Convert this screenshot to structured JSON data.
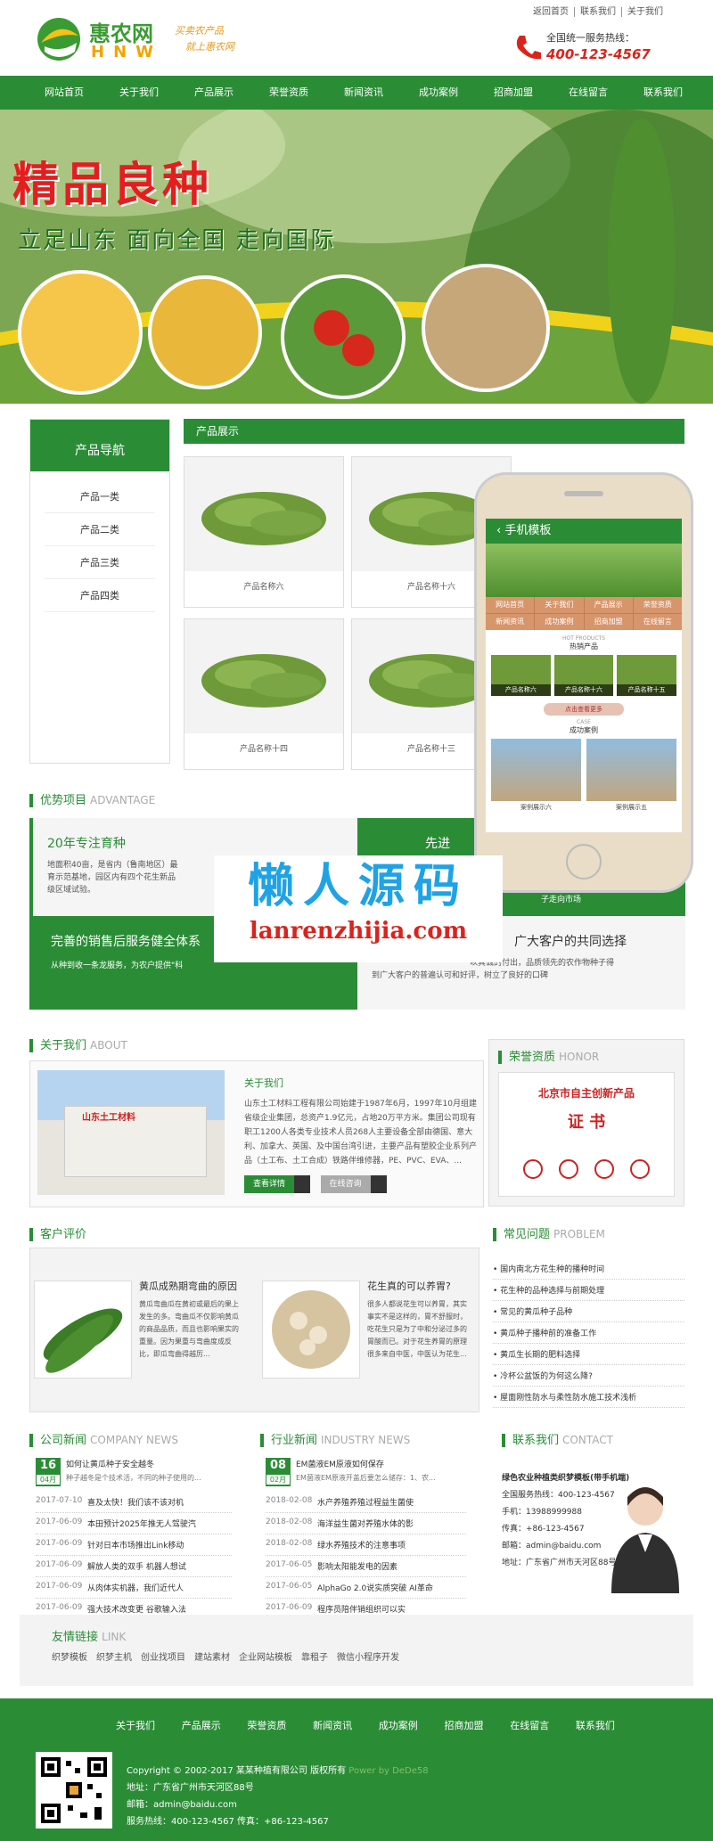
{
  "header": {
    "top_links": [
      "返回首页",
      "联系我们",
      "关于我们"
    ],
    "logo_cn": "惠农网",
    "logo_en": "HNW",
    "logo_slogan_1": "买卖农产品",
    "logo_slogan_2": "就上惠农网",
    "hotline_label": "全国统一服务热线：",
    "hotline_number": "400-123-4567"
  },
  "nav": [
    "网站首页",
    "关于我们",
    "产品展示",
    "荣誉资质",
    "新闻资讯",
    "成功案例",
    "招商加盟",
    "在线留言",
    "联系我们"
  ],
  "banner": {
    "title": "精品良种",
    "subtitle": "立足山东 面向全国 走向国际"
  },
  "sidenav": {
    "title": "产品导航",
    "items": [
      "产品一类",
      "产品二类",
      "产品三类",
      "产品四类"
    ]
  },
  "products": {
    "title": "产品展示",
    "items": [
      "产品名称六",
      "产品名称十六",
      "产品名称十四",
      "产品名称十三"
    ]
  },
  "phone": {
    "title": "手机模板",
    "menu": [
      "网站首页",
      "关于我们",
      "产品展示",
      "荣誉资质",
      "新闻资讯",
      "成功案例",
      "招商加盟",
      "在线留言"
    ],
    "hot_en": "HOT PRODUCTS",
    "hot_cn": "热销产品",
    "products": [
      "产品名称六",
      "产品名称十六",
      "产品名称十五"
    ],
    "more": "点击查看更多",
    "case_en": "CASE",
    "case_cn": "成功案例",
    "cases": [
      "案例展示六",
      "案例展示五"
    ]
  },
  "watermark": {
    "cn": "懒人源码",
    "en": "lanrenzhijia.com"
  },
  "advantage": {
    "title": "优势项目",
    "title_en": "ADVANTAGE",
    "item1_title": "20年专注育种",
    "item1_text_1": "地面积40亩，是省内（鲁南地区）最",
    "item1_text_2": "育示范基地，园区内有四个花生新品",
    "item1_text_3": "级区域试验。",
    "item2_title": "先进",
    "item2_side": "子走向市场",
    "item3_title": "完善的销售后服务健全体系",
    "item3_text": "从种到收一条龙服务，为农户提供\"科",
    "item4_title": "广大客户的共同选择",
    "item4_text_1": "以真诚的付出，品质领先的农作物种子得",
    "item4_text_2": "到广大客户的普遍认可和好评，树立了良好的口碑"
  },
  "about": {
    "title": "关于我们",
    "title_en": "ABOUT",
    "sub": "关于我们",
    "text": "山东土工材料工程有限公司始建于1987年6月，1997年10月组建省级企业集团，总资产1.9亿元，占地20万平方米。集团公司现有职工1200人各类专业技术人员268人主要设备全部由德国、意大利、加拿大、英国、及中国台湾引进，主要产品有塑胶企业系列产品（土工布、土工合成）铁路伴维修器，PE、PVC、EVA、...",
    "btn_more": "查看详情",
    "btn_msg": "在线咨询",
    "img_sign": "山东土工材料"
  },
  "honor": {
    "title": "荣誉资质",
    "title_en": "HONOR",
    "cert_head": "北京市自主创新产品",
    "cert_word": "证 书"
  },
  "reviews": {
    "title": "客户评价",
    "items": [
      {
        "title": "黄瓜成熟期弯曲的原因",
        "text": "黄瓜弯曲瓜在黄初或最后的果上发生的多。弯曲瓜不仅影响黄瓜的商品品质，而且也影响果实的重量。因为果重与弯曲度成反比，即瓜弯曲得越厉..."
      },
      {
        "title": "花生真的可以养胃?",
        "text": "很多人都说花生可以养胃，其实事实不是这样的，胃不舒服时，吃花生只是为了中和分泌过多的胃酸而已。对于花生养胃的原理很多来自中医，中医认为花生..."
      }
    ]
  },
  "faq": {
    "title": "常见问题",
    "title_en": "PROBLEM",
    "items": [
      "国内南北方花生种的播种时间",
      "花生种的品种选择与前期处理",
      "常见的黄瓜种子品种",
      "黄瓜种子播种前的准备工作",
      "黄瓜生长期的肥料选择",
      "冷杯公盆饭的为何这么降?",
      "屋面刚性防水与柔性防水施工技术浅析"
    ]
  },
  "company_news": {
    "title": "公司新闻",
    "title_en": "COMPANY NEWS",
    "top_day": "16",
    "top_month": "04月",
    "top_title": "如何让黄瓜种子安全越冬",
    "top_text": "种子越冬是个技术活，不同的种子使用的...",
    "items": [
      {
        "date": "2017-07-10",
        "title": "喜及太快！我们该不该对机"
      },
      {
        "date": "2017-06-09",
        "title": "本田预计2025年推无人驾驶汽"
      },
      {
        "date": "2017-06-09",
        "title": "针对日本市场推出Link移动"
      },
      {
        "date": "2017-06-09",
        "title": "解放人类的双手 机器人想试"
      },
      {
        "date": "2017-06-09",
        "title": "从肉体实机器，我们近代人"
      },
      {
        "date": "2017-06-09",
        "title": "强大技术改变更 谷歌输入法"
      }
    ]
  },
  "industry_news": {
    "title": "行业新闻",
    "title_en": "INDUSTRY NEWS",
    "top_day": "08",
    "top_month": "02月",
    "top_title": "EM菌液EM原液如何保存",
    "top_text": "EM菌液EM原液开盖后要怎么储存：1、农...",
    "items": [
      {
        "date": "2018-02-08",
        "title": "水产养殖养殖过程益生菌使"
      },
      {
        "date": "2018-02-08",
        "title": "海洋益生菌对养殖水体的影"
      },
      {
        "date": "2018-02-08",
        "title": "绿水养殖技术的注意事项"
      },
      {
        "date": "2017-06-05",
        "title": "影响太阳能发电的因素"
      },
      {
        "date": "2017-06-05",
        "title": "AlphaGo 2.0说实质突破 AI革命"
      },
      {
        "date": "2017-06-09",
        "title": "程序员陪伴销组织可以实"
      }
    ]
  },
  "contact": {
    "title": "联系我们",
    "title_en": "CONTACT",
    "company": "绿色农业种植类织梦模板(带手机端)",
    "lines": [
      "全国服务热线：400-123-4567",
      "手机：13988999988",
      "传真：+86-123-4567",
      "邮箱：admin@baidu.com",
      "地址：广东省广州市天河区88号"
    ]
  },
  "links": {
    "title": "友情链接",
    "title_en": "LINK",
    "items": [
      "织梦模板",
      "织梦主机",
      "创业找项目",
      "建站素材",
      "企业网站模板",
      "靠租子",
      "微信小程序开发"
    ]
  },
  "footer": {
    "nav": [
      "关于我们",
      "产品展示",
      "荣誉资质",
      "新闻资讯",
      "成功案例",
      "招商加盟",
      "在线留言",
      "联系我们"
    ],
    "copyright": "Copyright © 2002-2017 某某种植有限公司 版权所有",
    "powered": "Power by DeDe58",
    "address": "地址：广东省广州市天河区88号",
    "email": "邮箱：admin@baidu.com",
    "phone": "服务热线：400-123-4567 传真：+86-123-4567"
  }
}
